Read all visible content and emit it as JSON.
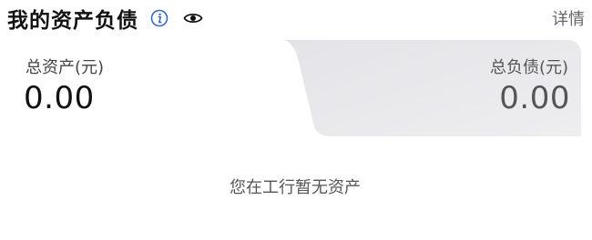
{
  "header": {
    "title": "我的资产负债",
    "detail_link": "详情",
    "info_icon": "info-icon",
    "visibility_icon": "eye-icon",
    "accent_color": "#2f6bd3"
  },
  "summary": {
    "assets_label": "总资产(元)",
    "assets_value": "0.00",
    "liabilities_label": "总负债(元)",
    "liabilities_value": "0.00"
  },
  "empty_state": {
    "message": "您在工行暂无资产"
  }
}
